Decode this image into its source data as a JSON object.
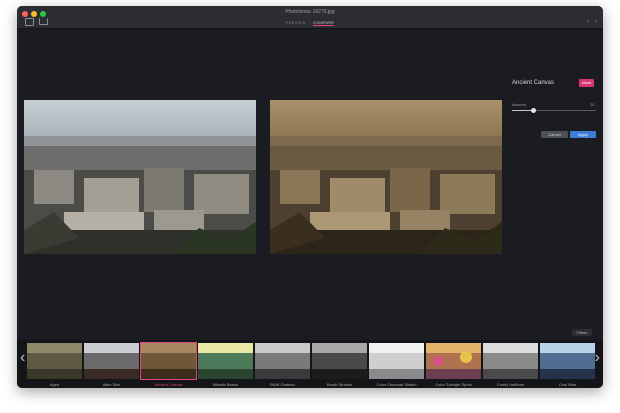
{
  "window": {
    "title": "Photolemur-16279.jpg"
  },
  "toolbar": {
    "tabs": [
      {
        "label": "PREVIEW"
      },
      {
        "label": "COMPARE"
      }
    ]
  },
  "panel": {
    "title": "Ancient Canvas",
    "badge": "Mask",
    "amount_label": "Amount",
    "amount_value": "20",
    "amount_fraction": 0.26,
    "cancel_label": "Cancel",
    "apply_label": "Apply"
  },
  "filters_button": "Filters",
  "filters": [
    {
      "label": "Aged"
    },
    {
      "label": "Alien Skin"
    },
    {
      "label": "Ancient Canvas"
    },
    {
      "label": "Atlantic Beach"
    },
    {
      "label": "B&W Grained"
    },
    {
      "label": "Brush Strokes"
    },
    {
      "label": "Color Charcoal Sketch"
    },
    {
      "label": "Color Sunlight Spots"
    },
    {
      "label": "Comic Halftone"
    },
    {
      "label": "Cool Blue"
    }
  ],
  "colors": {
    "accent": "#e0457b",
    "apply": "#3d7dd8",
    "window_bg": "#1a1c22"
  }
}
